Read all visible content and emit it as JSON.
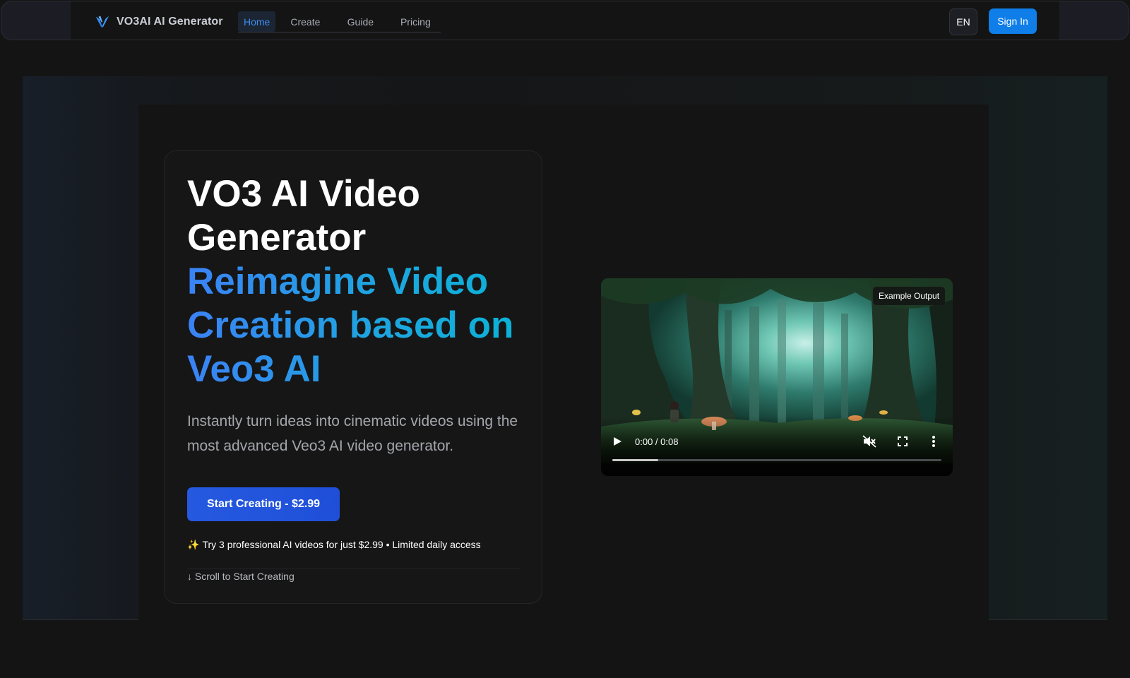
{
  "header": {
    "brand_name": "VO3AI AI Generator",
    "nav": [
      {
        "label": "Home",
        "active": true
      },
      {
        "label": "Create",
        "active": false
      },
      {
        "label": "Guide",
        "active": false
      },
      {
        "label": "Pricing",
        "active": false
      }
    ],
    "lang_label": "EN",
    "signin_label": "Sign In"
  },
  "hero": {
    "title_line1": "VO3 AI Video",
    "title_line2": "Generator",
    "subtitle_line1": "Reimagine Video",
    "subtitle_line2": "Creation based on",
    "subtitle_line3": "Veo3 AI",
    "description": "Instantly turn ideas into cinematic videos using the most advanced Veo3 AI video generator.",
    "cta_label": "Start Creating - $2.99",
    "trial_icon": "✨",
    "trial_text": "Try 3 professional AI videos for just $2.99 • Limited daily access",
    "scroll_hint": "↓ Scroll to Start Creating"
  },
  "video": {
    "badge": "Example Output",
    "time": "0:00 / 0:08",
    "progress_fraction": 0.14,
    "icons": {
      "play": "play-icon",
      "mute": "volume-muted-icon",
      "fullscreen": "fullscreen-icon",
      "more": "more-vertical-icon"
    }
  },
  "colors": {
    "accent": "#0f7ee8",
    "cta": "#2559e0",
    "nav_active": "#3b8ef0",
    "gradient_start": "#3b82f6",
    "gradient_end": "#0ab3d6"
  }
}
